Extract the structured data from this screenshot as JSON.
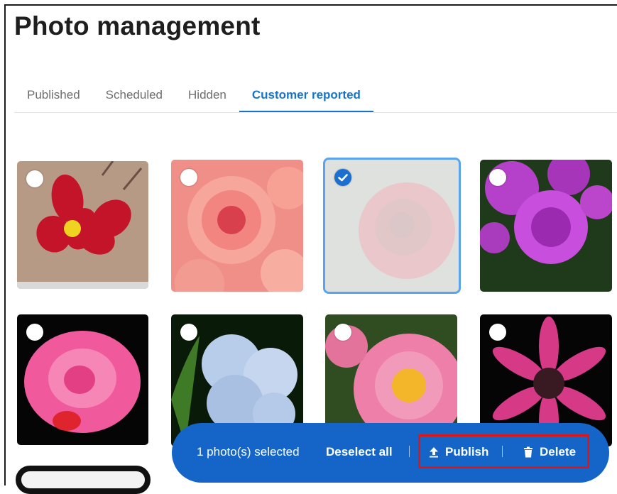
{
  "page": {
    "title": "Photo management"
  },
  "tabs": [
    {
      "label": "Published",
      "active": false
    },
    {
      "label": "Scheduled",
      "active": false
    },
    {
      "label": "Hidden",
      "active": false
    },
    {
      "label": "Customer reported",
      "active": true
    }
  ],
  "photos": [
    {
      "subject": "red cosmos flower",
      "selected": false
    },
    {
      "subject": "pink chrysanthemums",
      "selected": false
    },
    {
      "subject": "red rose",
      "selected": true
    },
    {
      "subject": "purple dahlias",
      "selected": false
    },
    {
      "subject": "pink rose with droplets",
      "selected": false
    },
    {
      "subject": "blue hydrangea",
      "selected": false
    },
    {
      "subject": "pink peony",
      "selected": false
    },
    {
      "subject": "magenta gerbera",
      "selected": false
    }
  ],
  "action_bar": {
    "selected_count_text": "1 photo(s) selected",
    "deselect_label": "Deselect all",
    "publish_label": "Publish",
    "delete_label": "Delete"
  },
  "colors": {
    "accent": "#1a73c8",
    "action_bar_bg": "#1565c8",
    "highlight_border": "#e01515",
    "selected_outline": "#5aa3ef"
  },
  "icons": {
    "publish": "upload-icon",
    "delete": "trash-icon",
    "check": "check-icon"
  }
}
